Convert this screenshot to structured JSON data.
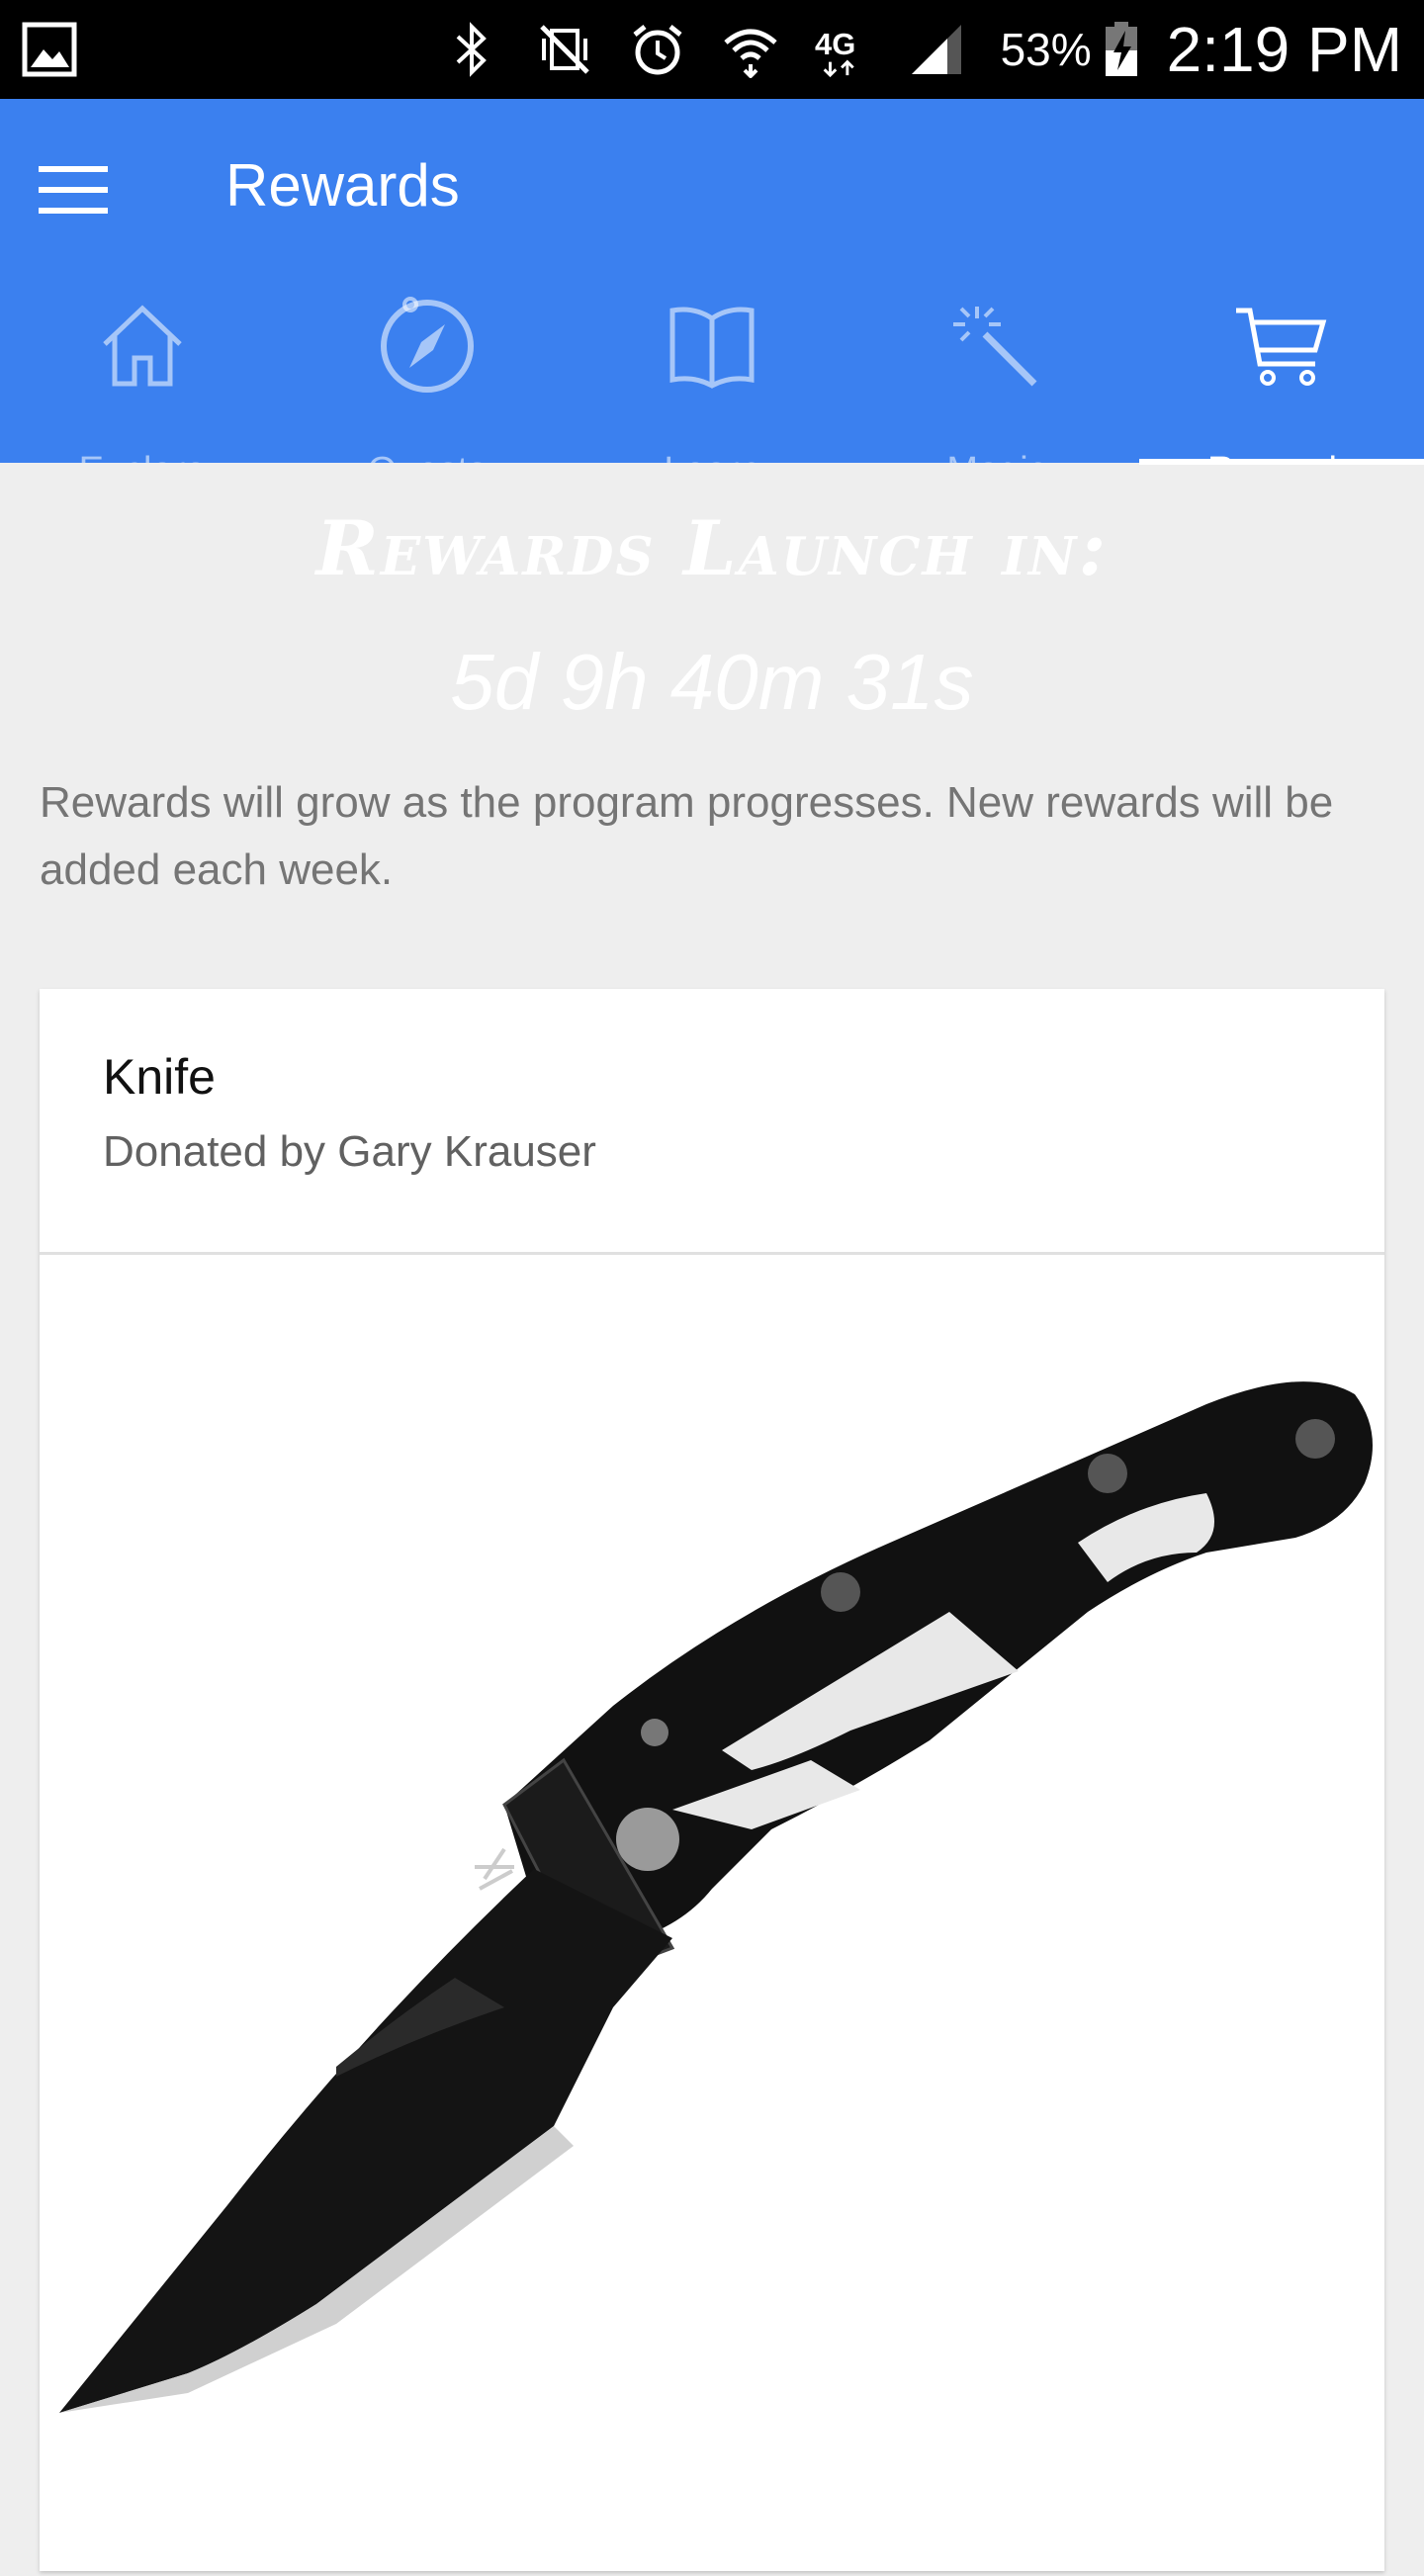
{
  "status_bar": {
    "battery_percent": "53%",
    "time": "2:19 PM",
    "network": "4G"
  },
  "app_bar": {
    "title": "Rewards"
  },
  "tabs": [
    {
      "label": "Explore",
      "icon": "home-icon",
      "active": false
    },
    {
      "label": "Quests",
      "icon": "compass-icon",
      "active": false
    },
    {
      "label": "Learn",
      "icon": "book-icon",
      "active": false
    },
    {
      "label": "Magic",
      "icon": "magic-wand-icon",
      "active": false
    },
    {
      "label": "Rewards",
      "icon": "cart-icon",
      "active": true
    }
  ],
  "content": {
    "headline": "Rewards Launch in:",
    "countdown": "5d 9h 40m 31s",
    "description": "Rewards will grow as the program progresses. New rewards will be added each week."
  },
  "reward_card": {
    "title": "Knife",
    "subtitle": "Donated by Gary Krauser",
    "image": "folding-knife-image"
  },
  "colors": {
    "accent": "#3b80ef",
    "background": "#eeeeee",
    "card": "#ffffff"
  }
}
